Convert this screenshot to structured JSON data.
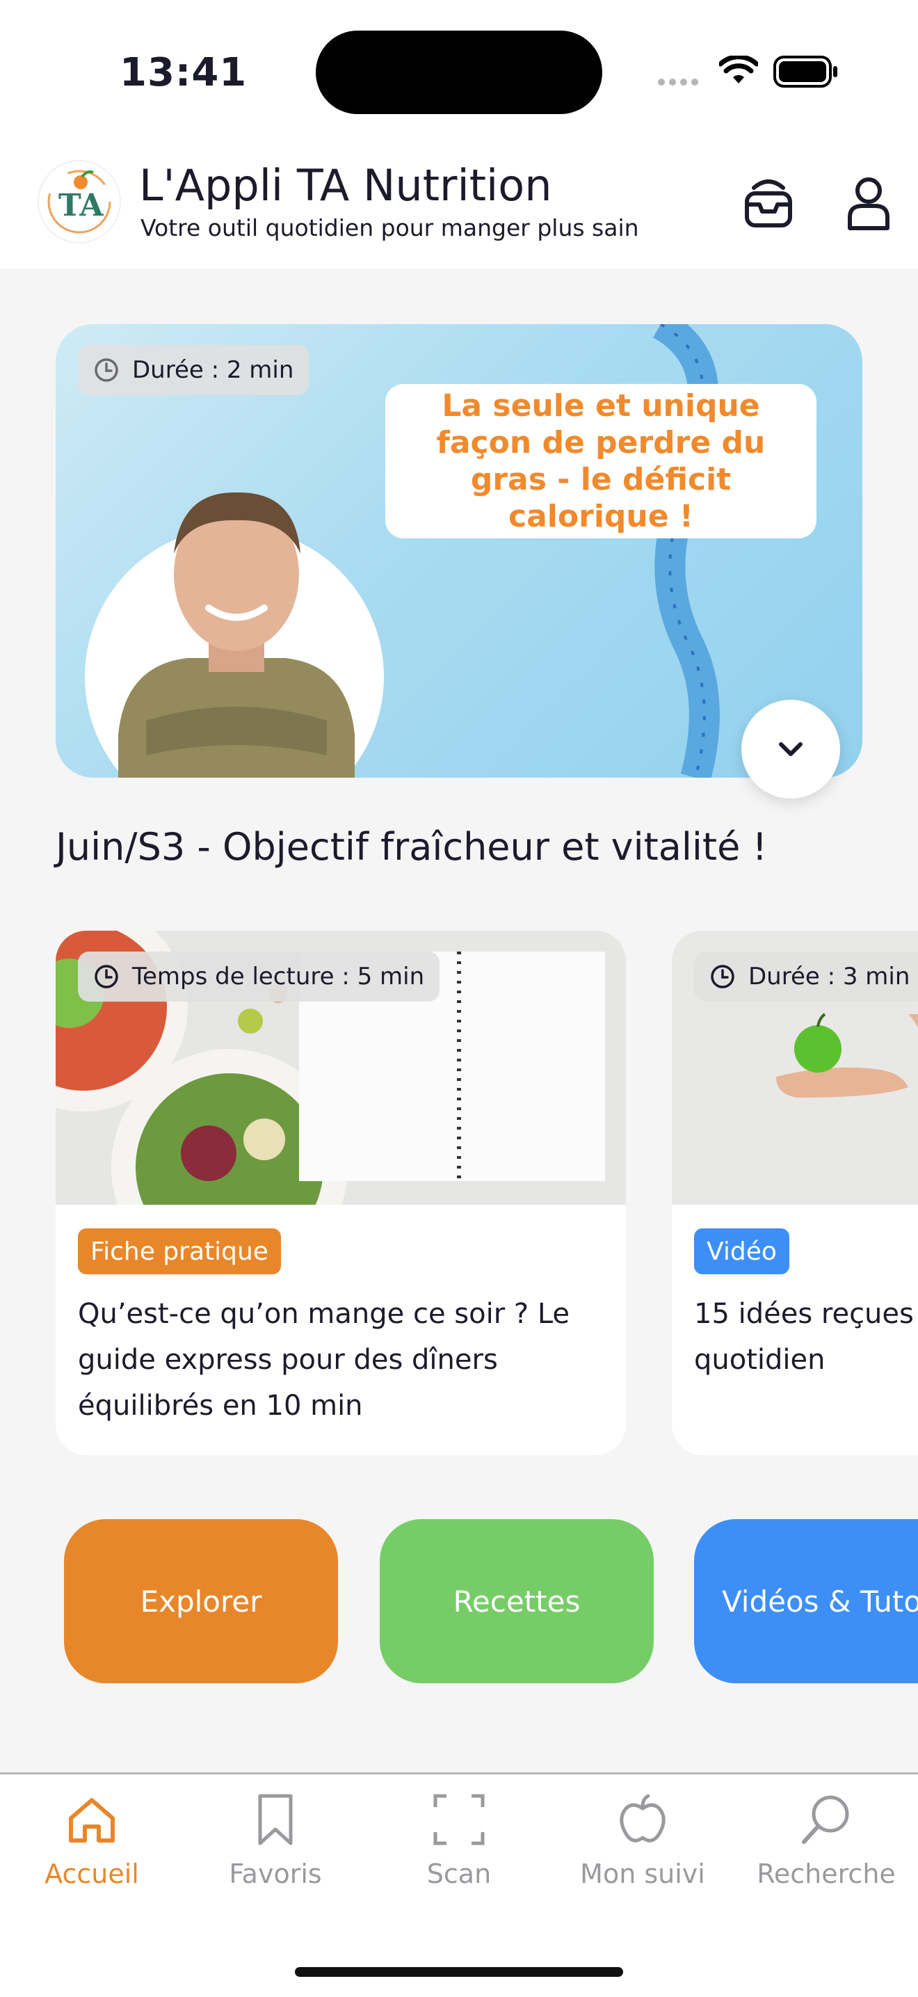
{
  "status_bar": {
    "time": "13:41"
  },
  "header": {
    "title": "L'Appli TA Nutrition",
    "subtitle": "Votre outil quotidien pour manger plus sain",
    "logo_text": "TA"
  },
  "hero": {
    "duration": "Durée : 2 min",
    "quote": "La seule et unique façon de perdre du gras - le déficit calorique !"
  },
  "section_title": "Juin/S3 - Objectif fraîcheur et vitalité !",
  "cards": [
    {
      "badge": "Temps de lecture : 5 min",
      "tag": "Fiche pratique",
      "tag_color": "#e8872a",
      "title": "Qu’est-ce qu’on mange ce soir ? Le guide express pour des dîners équilibrés en 10 min"
    },
    {
      "badge": "Durée : 3 min",
      "tag": "Vidéo",
      "tag_color": "#3d8ff6",
      "title": "15 idées reçues quotidien"
    }
  ],
  "buttons": [
    {
      "label": "Explorer",
      "color": "#e8872a"
    },
    {
      "label": "Recettes",
      "color": "#76cd67"
    },
    {
      "label": "Vidéos & Tuto",
      "color": "#3d8ff6"
    }
  ],
  "tabs": [
    {
      "label": "Accueil",
      "icon": "home-icon",
      "active": true
    },
    {
      "label": "Favoris",
      "icon": "bookmark-icon"
    },
    {
      "label": "Scan",
      "icon": "scan-icon"
    },
    {
      "label": "Mon suivi",
      "icon": "apple-icon"
    },
    {
      "label": "Recherche",
      "icon": "search-icon"
    }
  ]
}
